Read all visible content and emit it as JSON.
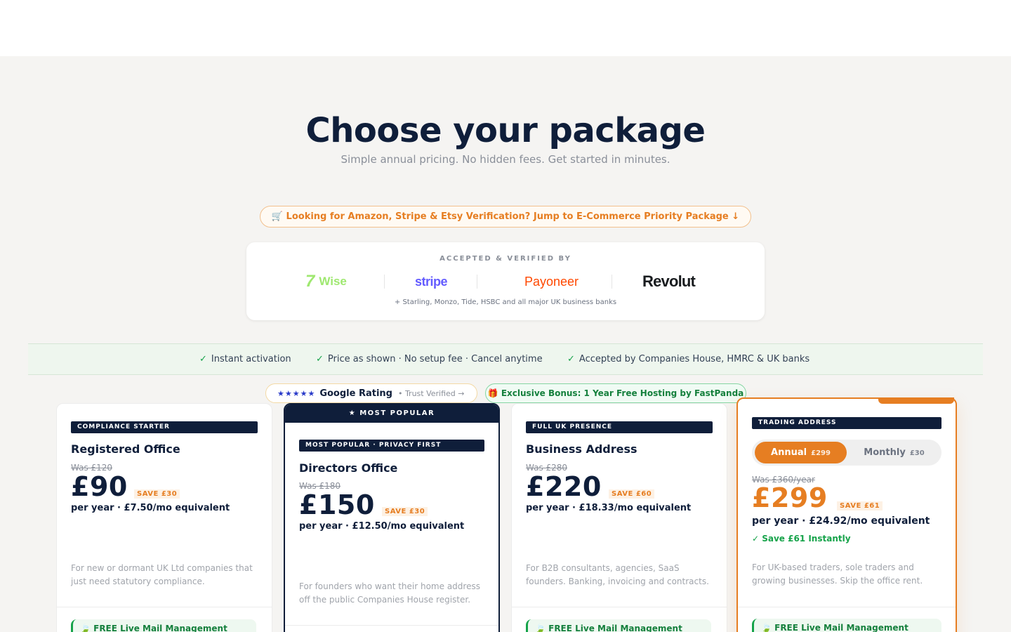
{
  "hero": {
    "title": "Choose your package",
    "subtitle": "Simple annual pricing. No hidden fees. Get started in minutes."
  },
  "ecommerce_pill": "🛒 Looking for Amazon, Stripe & Etsy Verification?  Jump to E-Commerce Priority Package ↓",
  "verified": {
    "label": "ACCEPTED & VERIFIED BY",
    "logos": [
      "Wise",
      "stripe",
      "Payoneer",
      "Revolut"
    ],
    "footnote": "+ Starling, Monzo, Tide, HSBC and all major UK business banks"
  },
  "trust_items": [
    "Instant activation",
    "Price as shown · No setup fee · Cancel anytime",
    "Accepted by Companies House, HMRC & UK banks"
  ],
  "badges": {
    "stars": "★★★★★",
    "google_rating": "Google Rating",
    "trust_verified": "• Trust Verified →",
    "bonus": "🎁 Exclusive Bonus: 1 Year Free Hosting by FastPanda"
  },
  "plans": [
    {
      "tag": "COMPLIANCE STARTER",
      "name": "Registered Office",
      "was": "Was £120",
      "price": "£90",
      "save": "SAVE £30",
      "per": "per year · £7.50/mo equivalent",
      "desc": "For new or dormant UK Ltd companies that just need statutory compliance.",
      "feature": "🍃 FREE Live Mail Management"
    },
    {
      "header": "★ MOST POPULAR",
      "tag": "MOST POPULAR · PRIVACY FIRST",
      "name": "Directors Office",
      "was": "Was £180",
      "price": "£150",
      "save": "SAVE £30",
      "per": "per year · £12.50/mo equivalent",
      "desc": "For founders who want their home address off the public Companies House register."
    },
    {
      "tag": "FULL UK PRESENCE",
      "name": "Business Address",
      "was": "Was £280",
      "price": "£220",
      "save": "SAVE £60",
      "per": "per year · £18.33/mo equivalent",
      "desc": "For B2B consultants, agencies, SaaS founders. Banking, invoicing and contracts.",
      "feature": "🍃 FREE Live Mail Management"
    },
    {
      "tag": "TRADING ADDRESS",
      "toggle_annual": "Annual",
      "toggle_annual_price": "£299",
      "toggle_monthly": "Monthly",
      "toggle_monthly_price": "£30",
      "was": "Was £360/year",
      "price": "£299",
      "save": "SAVE £61",
      "per": "per year · £24.92/mo equivalent",
      "instant": "✓ Save £61 Instantly",
      "desc": "For UK-based traders, sole traders and growing businesses. Skip the office rent.",
      "feature": "🍃 FREE Live Mail Management"
    }
  ],
  "colors": {
    "navy": "#0f1e3a",
    "orange": "#e67e22",
    "green": "#16a34a",
    "background": "#f5f4f2"
  }
}
